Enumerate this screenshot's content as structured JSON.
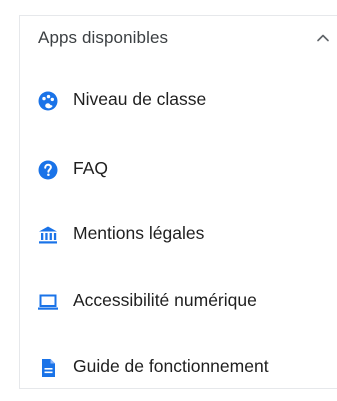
{
  "panel": {
    "title": "Apps disponibles",
    "expanded": true,
    "chevron_icon": "chevron-up-icon",
    "accent_color": "#1a73e8",
    "items": [
      {
        "label": "Niveau de classe",
        "icon": "palette-icon"
      },
      {
        "label": "FAQ",
        "icon": "help-circle-icon"
      },
      {
        "label": "Mentions légales",
        "icon": "bank-icon"
      },
      {
        "label": "Accessibilité numérique",
        "icon": "laptop-icon"
      },
      {
        "label": "Guide de fonctionnement",
        "icon": "document-icon"
      }
    ]
  }
}
